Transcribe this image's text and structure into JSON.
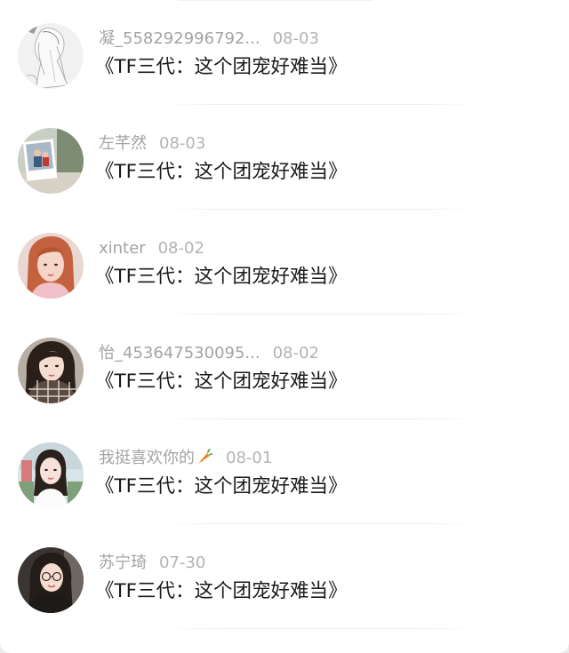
{
  "comments": [
    {
      "username": "凝_558292996792...",
      "date": "08-03",
      "text": "《TF三代：这个团宠好难当》",
      "avatar_icon": "sketch-girl-avatar-icon"
    },
    {
      "username": "左芊然",
      "date": "08-03",
      "text": "《TF三代：这个团宠好难当》",
      "avatar_icon": "photo-card-avatar-icon"
    },
    {
      "username": "xinter",
      "date": "08-02",
      "text": "《TF三代：这个团宠好难当》",
      "avatar_icon": "red-hair-girl-avatar-icon"
    },
    {
      "username": "怡_453647530095...",
      "date": "08-02",
      "text": "《TF三代：这个团宠好难当》",
      "avatar_icon": "plaid-scarf-girl-avatar-icon"
    },
    {
      "username": "我挺喜欢你的",
      "username_emoji": "carrot-icon",
      "date": "08-01",
      "text": "《TF三代：这个团宠好难当》",
      "avatar_icon": "white-dress-girl-avatar-icon"
    },
    {
      "username": "苏宁琦",
      "date": "07-30",
      "text": "《TF三代：这个团宠好难当》",
      "avatar_icon": "glasses-girl-avatar-icon"
    }
  ],
  "colors": {
    "username": "#a3a3a3",
    "date": "#b3b3b3",
    "text": "#1a1a1a",
    "separator": "#ececec",
    "background": "#ffffff"
  }
}
